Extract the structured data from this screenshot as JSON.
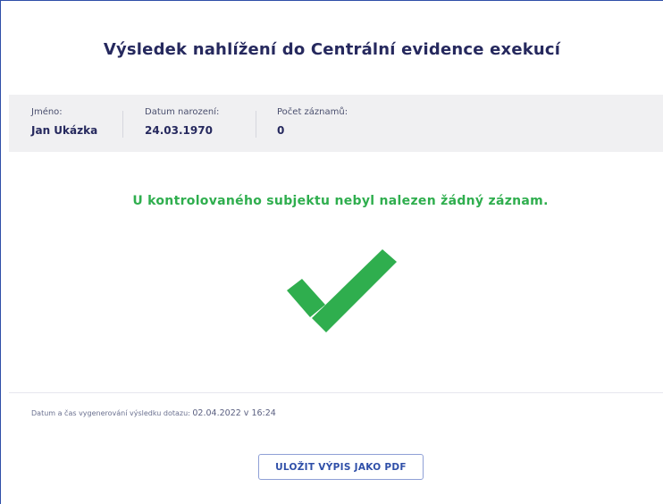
{
  "header": {
    "title": "Výsledek nahlížení do Centrální evidence exekucí"
  },
  "subject": {
    "name_label": "Jméno:",
    "name_value": "Jan Ukázka",
    "birth_label": "Datum narození:",
    "birth_value": "24.03.1970",
    "count_label": "Počet záznamů:",
    "count_value": "0"
  },
  "result": {
    "message": "U kontrolovaného subjektu nebyl nalezen žádný záznam.",
    "icon": "checkmark-icon",
    "color": "#2fae4e"
  },
  "footer": {
    "timestamp_label": "Datum a čas vygenerování výsledku dotazu:",
    "timestamp_value": "02.04.2022 v 16:24"
  },
  "actions": {
    "save_pdf_label": "ULOŽIT VÝPIS JAKO PDF"
  },
  "colors": {
    "accent": "#2f4fa8",
    "title": "#26295e",
    "success": "#2fae4e",
    "info_bar_bg": "#f0f0f2"
  }
}
